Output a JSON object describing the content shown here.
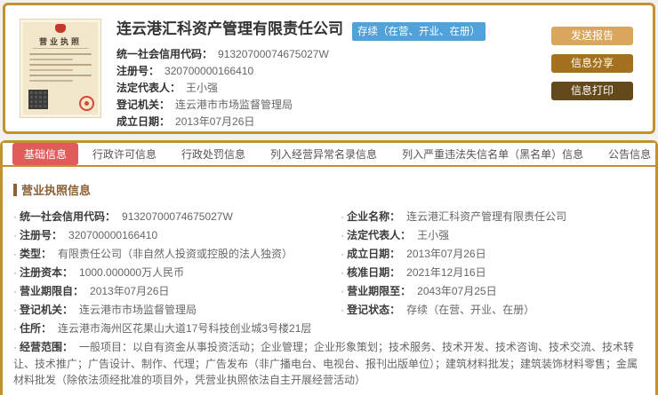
{
  "colors": {
    "card_border_gold": "#c3922e",
    "active_tab_red": "#e25b5b",
    "status_badge_blue": "#4fa3da",
    "btn_report": "#d8a75d",
    "btn_share": "#a4721e",
    "btn_print": "#64491b",
    "section_title_brown": "#8d5f33"
  },
  "header": {
    "company_name": "连云港汇科资产管理有限责任公司",
    "status_badge": "存续（在营、开业、在册）",
    "license_thumb_title": "营业执照",
    "fields": [
      {
        "label": "统一社会信用代码：",
        "value": "91320700074675027W"
      },
      {
        "label": "注册号：",
        "value": "320700000166410"
      },
      {
        "label": "法定代表人：",
        "value": "王小强"
      },
      {
        "label": "登记机关：",
        "value": "连云港市市场监督管理局"
      },
      {
        "label": "成立日期：",
        "value": "2013年07月26日"
      }
    ],
    "buttons": [
      {
        "label": "发送报告"
      },
      {
        "label": "信息分享"
      },
      {
        "label": "信息打印"
      }
    ]
  },
  "tabs": {
    "items": [
      {
        "label": "基础信息",
        "active": true
      },
      {
        "label": "行政许可信息",
        "active": false
      },
      {
        "label": "行政处罚信息",
        "active": false
      },
      {
        "label": "列入经营异常名录信息",
        "active": false
      },
      {
        "label": "列入严重违法失信名单（黑名单）信息",
        "active": false
      },
      {
        "label": "公告信息",
        "active": false
      }
    ]
  },
  "license_section": {
    "title": "营业执照信息",
    "left": [
      {
        "label": "统一社会信用代码：",
        "value": "91320700074675027W"
      },
      {
        "label": "注册号：",
        "value": "320700000166410"
      },
      {
        "label": "类型：",
        "value": "有限责任公司（非自然人投资或控股的法人独资）"
      },
      {
        "label": "注册资本：",
        "value": "1000.000000万人民币"
      },
      {
        "label": "营业期限自：",
        "value": "2013年07月26日"
      },
      {
        "label": "登记机关：",
        "value": "连云港市市场监督管理局"
      }
    ],
    "right": [
      {
        "label": "企业名称：",
        "value": "连云港汇科资产管理有限责任公司"
      },
      {
        "label": "法定代表人：",
        "value": "王小强"
      },
      {
        "label": "成立日期：",
        "value": "2013年07月26日"
      },
      {
        "label": "核准日期：",
        "value": "2021年12月16日"
      },
      {
        "label": "营业期限至：",
        "value": "2043年07月25日"
      },
      {
        "label": "登记状态：",
        "value": "存续（在营、开业、在册）"
      }
    ],
    "full": [
      {
        "label": "住所：",
        "value": "连云港市海州区花果山大道17号科技创业城3号楼21层"
      },
      {
        "label": "经营范围：",
        "value": "一般项目：以自有资金从事投资活动；企业管理；企业形象策划；技术服务、技术开发、技术咨询、技术交流、技术转让、技术推广；广告设计、制作、代理；广告发布（非广播电台、电视台、报刊出版单位）；建筑材料批发；建筑装饰材料零售；金属材料批发（除依法须经批准的项目外，凭营业执照依法自主开展经营活动）"
      }
    ]
  }
}
